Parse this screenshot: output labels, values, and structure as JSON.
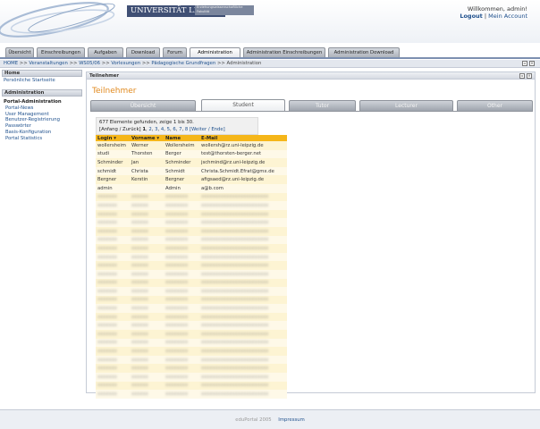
{
  "header": {
    "university": "UNIVERSITÄT LEIPZIG",
    "faculty_badge": "Erziehungswissenschaftliche Fakultät",
    "welcome": "Willkommen, admin!",
    "logout": "Logout",
    "separator": "|",
    "my_account": "Mein Account"
  },
  "tabs": [
    {
      "label": "Übersicht"
    },
    {
      "label": "Einschreibungen"
    },
    {
      "label": "Aufgaben"
    },
    {
      "label": "Download"
    },
    {
      "label": "Forum"
    },
    {
      "label": "Administration"
    },
    {
      "label": "Administration Einschreibungen"
    },
    {
      "label": "Administration Download"
    }
  ],
  "breadcrumb": {
    "items": [
      "HOME",
      "Veranstaltungen",
      "WS05/06",
      "Vorlesungen",
      "Pädagogische Grundfragen",
      "Administration"
    ],
    "sep": ">>"
  },
  "sidebar": {
    "home_head": "Home",
    "personal_page": "Persönliche Startseite",
    "admin_head": "Administration",
    "portal_admin": "Portal-Administration",
    "links": [
      "Portal-News",
      "User Management",
      "Benutzer-Registrierung",
      "Passwörter",
      "Basis-Konfiguration",
      "Portal Statistics"
    ]
  },
  "panel": {
    "head": "Teilnehmer",
    "title": "Teilnehmer",
    "subtabs": [
      "Übersicht",
      "Student",
      "Tutor",
      "Lecturer",
      "Other"
    ]
  },
  "paging": {
    "found": "677 Elemente gefunden, zeige 1 bis 30.",
    "open": "[",
    "first_back": "Anfang / Zurück",
    "close": "]",
    "current": "1",
    "pages": [
      "2",
      "3",
      "4",
      "5",
      "6",
      "7",
      "8"
    ],
    "next_last": "[Weiter / Ende]"
  },
  "table": {
    "headers": [
      "Login",
      "Vorname",
      "Name",
      "E-Mail"
    ],
    "rows": [
      [
        "wollersheim",
        "Werner",
        "Wollersheim",
        "wollersh@rz.uni-leipzig.de"
      ],
      [
        "studi",
        "Thorsten",
        "Berger",
        "test@thorsten-berger.net"
      ],
      [
        "Schminder",
        "Jan",
        "Schminder",
        "jschmind@rz.uni-leipzig.de"
      ],
      [
        "schmidt",
        "Christa",
        "Schmidt",
        "Christa.Schmidt.Efrat@gmx.de"
      ],
      [
        "Bergner",
        "Kerstin",
        "Bergner",
        "afigsaed@rz.uni-leipzig.de"
      ],
      [
        "admin",
        "",
        "Admin",
        "a@b.com"
      ]
    ],
    "blurred_rows": 24
  },
  "footer": {
    "copyright": "eduPortal 2005",
    "impressum": "Impressum"
  },
  "colors": {
    "accent": "#f5b619",
    "title": "#e18a1f",
    "link": "#1d4f8c"
  }
}
